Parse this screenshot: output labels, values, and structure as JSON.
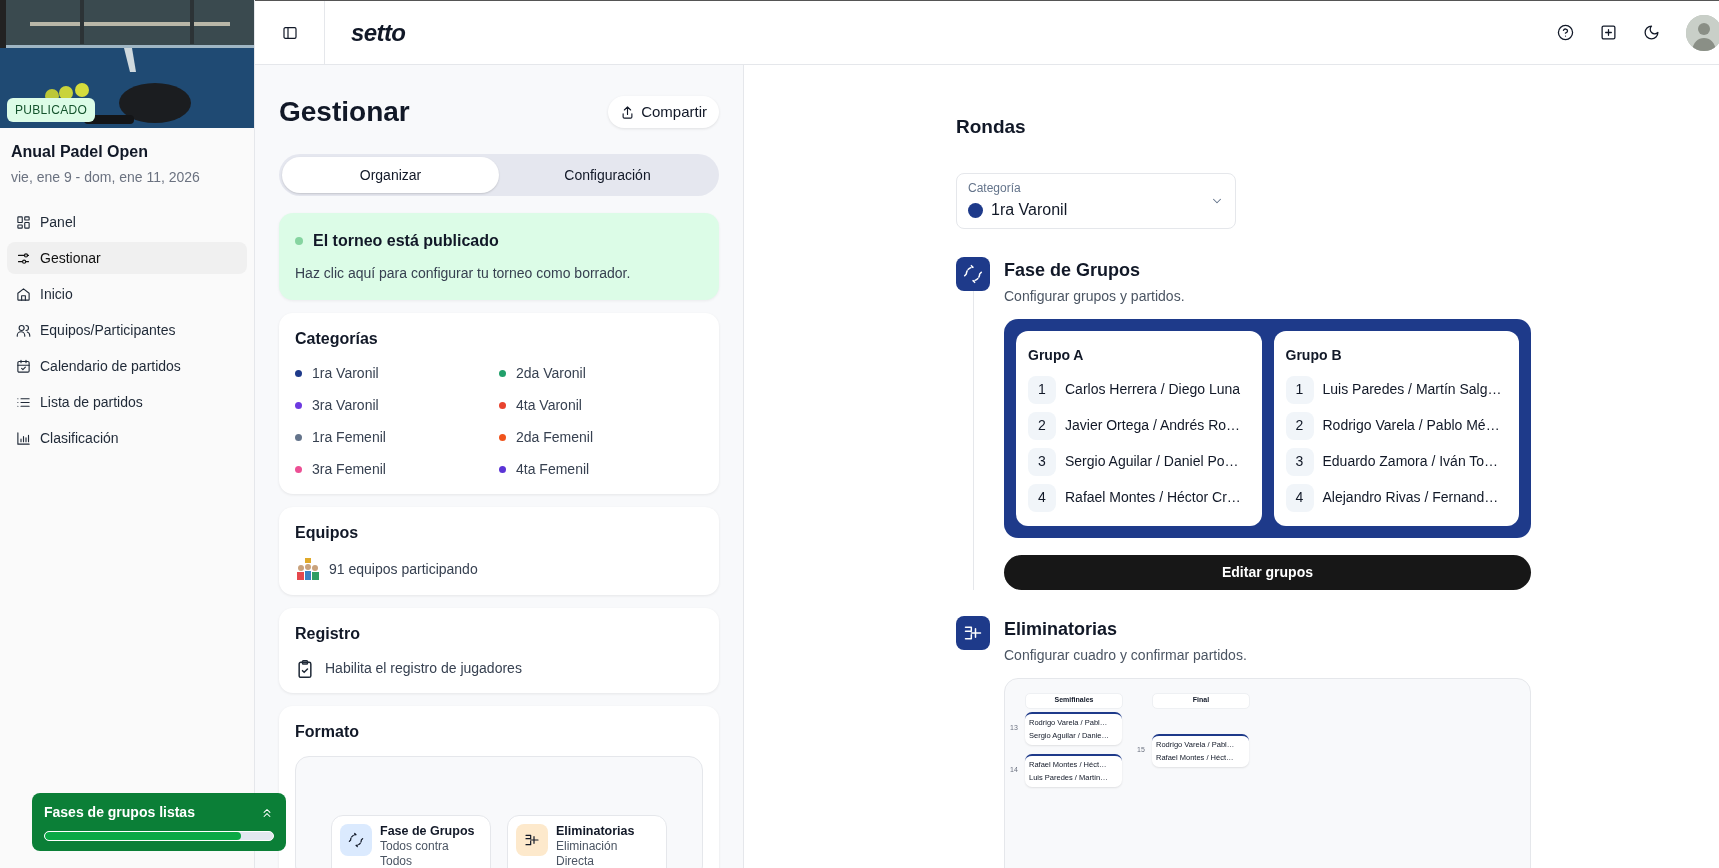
{
  "sidebar": {
    "badge": "PUBLICADO",
    "title": "Anual Padel Open",
    "dates": "vie, ene 9 - dom, ene 11, 2026",
    "items": [
      {
        "label": "Panel",
        "selected": false
      },
      {
        "label": "Gestionar",
        "selected": true
      },
      {
        "label": "Inicio",
        "selected": false
      },
      {
        "label": "Equipos/Participantes",
        "selected": false
      },
      {
        "label": "Calendario de partidos",
        "selected": false
      },
      {
        "label": "Lista de partidos",
        "selected": false
      },
      {
        "label": "Clasificación",
        "selected": false
      }
    ]
  },
  "header": {
    "logo": "setto"
  },
  "main": {
    "title": "Gestionar",
    "share_button": "Compartir",
    "tabs": [
      {
        "label": "Organizar",
        "selected": true
      },
      {
        "label": "Configuración",
        "selected": false
      }
    ],
    "status": {
      "title": "El torneo está publicado",
      "text": "Haz clic aquí para configurar tu torneo como borrador."
    },
    "categories": {
      "title": "Categorías",
      "items": [
        {
          "label": "1ra Varonil",
          "color": "#1e3a8a"
        },
        {
          "label": "2da Varonil",
          "color": "#22a06b"
        },
        {
          "label": "3ra Varonil",
          "color": "#6d3ae0"
        },
        {
          "label": "4ta Varonil",
          "color": "#e8432e"
        },
        {
          "label": "1ra Femenil",
          "color": "#64748b"
        },
        {
          "label": "2da Femenil",
          "color": "#f0531c"
        },
        {
          "label": "3ra Femenil",
          "color": "#ec4f94"
        },
        {
          "label": "4ta Femenil",
          "color": "#5b34d6"
        }
      ]
    },
    "teams": {
      "title": "Equipos",
      "text": "91 equipos participando"
    },
    "registration": {
      "title": "Registro",
      "text": "Habilita el registro de jugadores"
    },
    "format": {
      "title": "Formato",
      "options": [
        {
          "title": "Fase de Grupos",
          "subtitle": "Todos contra Todos"
        },
        {
          "title": "Eliminatorias",
          "subtitle": "Eliminación Directa"
        }
      ]
    }
  },
  "rounds": {
    "title": "Rondas",
    "category_select": {
      "label": "Categoría",
      "value": "1ra Varonil",
      "color": "#1e3a8a"
    },
    "stages": [
      {
        "kind": "groups",
        "title": "Fase de Grupos",
        "subtitle": "Configurar grupos y partidos.",
        "button": "Editar grupos",
        "groups": [
          {
            "name": "Grupo A",
            "teams": [
              {
                "seed": "1",
                "name": "Carlos Herrera / Diego Luna"
              },
              {
                "seed": "2",
                "name": "Javier Ortega / Andrés Ro…"
              },
              {
                "seed": "3",
                "name": "Sergio Aguilar / Daniel Po…"
              },
              {
                "seed": "4",
                "name": "Rafael Montes / Héctor Cr…"
              }
            ]
          },
          {
            "name": "Grupo B",
            "teams": [
              {
                "seed": "1",
                "name": "Luis Paredes / Martín Salg…"
              },
              {
                "seed": "2",
                "name": "Rodrigo Varela / Pablo Mé…"
              },
              {
                "seed": "3",
                "name": "Eduardo Zamora / Iván To…"
              },
              {
                "seed": "4",
                "name": "Alejandro Rivas / Fernand…"
              }
            ]
          }
        ]
      },
      {
        "kind": "bracket",
        "title": "Eliminatorias",
        "subtitle": "Configurar cuadro y confirmar partidos.",
        "rounds": [
          {
            "name": "Semifinales",
            "matches": [
              {
                "number": "13",
                "teams": [
                  "Rodrigo Varela / Pabl…",
                  "Sergio Aguilar / Danie…"
                ]
              },
              {
                "number": "14",
                "teams": [
                  "Rafael Montes / Héct…",
                  "Luis Paredes / Martín…"
                ]
              }
            ]
          },
          {
            "name": "Final",
            "matches": [
              {
                "number": "15",
                "teams": [
                  "Rodrigo Varela / Pabl…",
                  "Rafael Montes / Héct…"
                ]
              }
            ]
          }
        ]
      }
    ]
  },
  "toast": {
    "title": "Fases de grupos listas",
    "level": 0.86
  }
}
